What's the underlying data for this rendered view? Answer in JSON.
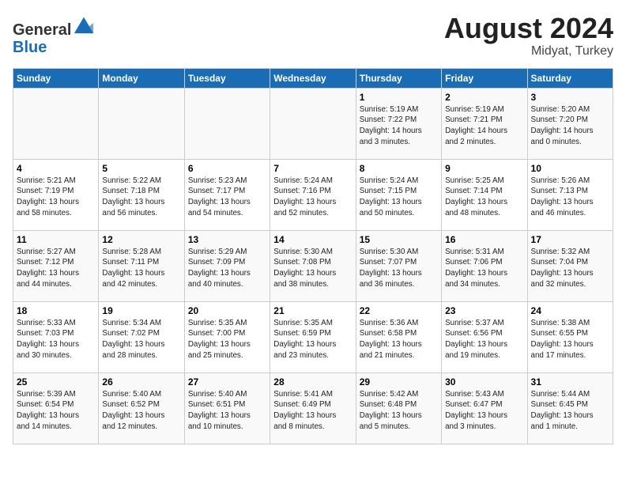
{
  "header": {
    "logo_line1": "General",
    "logo_line2": "Blue",
    "title": "August 2024",
    "subtitle": "Midyat, Turkey"
  },
  "calendar": {
    "days_of_week": [
      "Sunday",
      "Monday",
      "Tuesday",
      "Wednesday",
      "Thursday",
      "Friday",
      "Saturday"
    ],
    "weeks": [
      [
        {
          "day": "",
          "info": ""
        },
        {
          "day": "",
          "info": ""
        },
        {
          "day": "",
          "info": ""
        },
        {
          "day": "",
          "info": ""
        },
        {
          "day": "1",
          "info": "Sunrise: 5:19 AM\nSunset: 7:22 PM\nDaylight: 14 hours\nand 3 minutes."
        },
        {
          "day": "2",
          "info": "Sunrise: 5:19 AM\nSunset: 7:21 PM\nDaylight: 14 hours\nand 2 minutes."
        },
        {
          "day": "3",
          "info": "Sunrise: 5:20 AM\nSunset: 7:20 PM\nDaylight: 14 hours\nand 0 minutes."
        }
      ],
      [
        {
          "day": "4",
          "info": "Sunrise: 5:21 AM\nSunset: 7:19 PM\nDaylight: 13 hours\nand 58 minutes."
        },
        {
          "day": "5",
          "info": "Sunrise: 5:22 AM\nSunset: 7:18 PM\nDaylight: 13 hours\nand 56 minutes."
        },
        {
          "day": "6",
          "info": "Sunrise: 5:23 AM\nSunset: 7:17 PM\nDaylight: 13 hours\nand 54 minutes."
        },
        {
          "day": "7",
          "info": "Sunrise: 5:24 AM\nSunset: 7:16 PM\nDaylight: 13 hours\nand 52 minutes."
        },
        {
          "day": "8",
          "info": "Sunrise: 5:24 AM\nSunset: 7:15 PM\nDaylight: 13 hours\nand 50 minutes."
        },
        {
          "day": "9",
          "info": "Sunrise: 5:25 AM\nSunset: 7:14 PM\nDaylight: 13 hours\nand 48 minutes."
        },
        {
          "day": "10",
          "info": "Sunrise: 5:26 AM\nSunset: 7:13 PM\nDaylight: 13 hours\nand 46 minutes."
        }
      ],
      [
        {
          "day": "11",
          "info": "Sunrise: 5:27 AM\nSunset: 7:12 PM\nDaylight: 13 hours\nand 44 minutes."
        },
        {
          "day": "12",
          "info": "Sunrise: 5:28 AM\nSunset: 7:11 PM\nDaylight: 13 hours\nand 42 minutes."
        },
        {
          "day": "13",
          "info": "Sunrise: 5:29 AM\nSunset: 7:09 PM\nDaylight: 13 hours\nand 40 minutes."
        },
        {
          "day": "14",
          "info": "Sunrise: 5:30 AM\nSunset: 7:08 PM\nDaylight: 13 hours\nand 38 minutes."
        },
        {
          "day": "15",
          "info": "Sunrise: 5:30 AM\nSunset: 7:07 PM\nDaylight: 13 hours\nand 36 minutes."
        },
        {
          "day": "16",
          "info": "Sunrise: 5:31 AM\nSunset: 7:06 PM\nDaylight: 13 hours\nand 34 minutes."
        },
        {
          "day": "17",
          "info": "Sunrise: 5:32 AM\nSunset: 7:04 PM\nDaylight: 13 hours\nand 32 minutes."
        }
      ],
      [
        {
          "day": "18",
          "info": "Sunrise: 5:33 AM\nSunset: 7:03 PM\nDaylight: 13 hours\nand 30 minutes."
        },
        {
          "day": "19",
          "info": "Sunrise: 5:34 AM\nSunset: 7:02 PM\nDaylight: 13 hours\nand 28 minutes."
        },
        {
          "day": "20",
          "info": "Sunrise: 5:35 AM\nSunset: 7:00 PM\nDaylight: 13 hours\nand 25 minutes."
        },
        {
          "day": "21",
          "info": "Sunrise: 5:35 AM\nSunset: 6:59 PM\nDaylight: 13 hours\nand 23 minutes."
        },
        {
          "day": "22",
          "info": "Sunrise: 5:36 AM\nSunset: 6:58 PM\nDaylight: 13 hours\nand 21 minutes."
        },
        {
          "day": "23",
          "info": "Sunrise: 5:37 AM\nSunset: 6:56 PM\nDaylight: 13 hours\nand 19 minutes."
        },
        {
          "day": "24",
          "info": "Sunrise: 5:38 AM\nSunset: 6:55 PM\nDaylight: 13 hours\nand 17 minutes."
        }
      ],
      [
        {
          "day": "25",
          "info": "Sunrise: 5:39 AM\nSunset: 6:54 PM\nDaylight: 13 hours\nand 14 minutes."
        },
        {
          "day": "26",
          "info": "Sunrise: 5:40 AM\nSunset: 6:52 PM\nDaylight: 13 hours\nand 12 minutes."
        },
        {
          "day": "27",
          "info": "Sunrise: 5:40 AM\nSunset: 6:51 PM\nDaylight: 13 hours\nand 10 minutes."
        },
        {
          "day": "28",
          "info": "Sunrise: 5:41 AM\nSunset: 6:49 PM\nDaylight: 13 hours\nand 8 minutes."
        },
        {
          "day": "29",
          "info": "Sunrise: 5:42 AM\nSunset: 6:48 PM\nDaylight: 13 hours\nand 5 minutes."
        },
        {
          "day": "30",
          "info": "Sunrise: 5:43 AM\nSunset: 6:47 PM\nDaylight: 13 hours\nand 3 minutes."
        },
        {
          "day": "31",
          "info": "Sunrise: 5:44 AM\nSunset: 6:45 PM\nDaylight: 13 hours\nand 1 minute."
        }
      ]
    ]
  }
}
